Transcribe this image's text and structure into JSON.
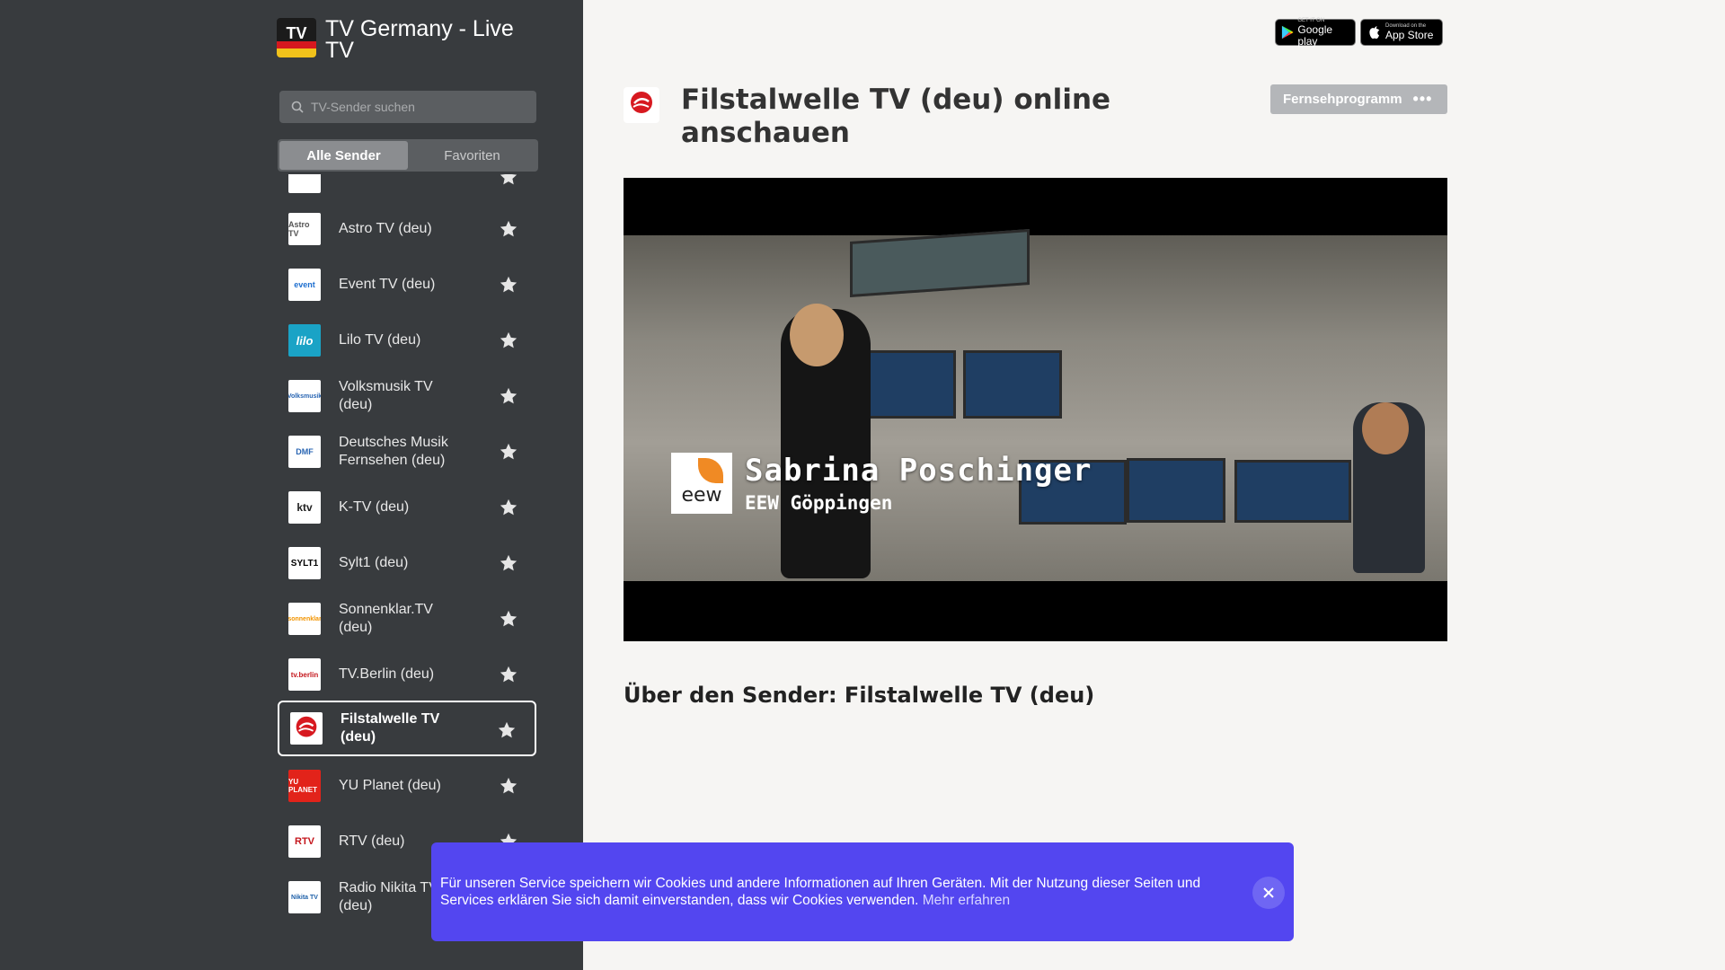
{
  "brand": {
    "title": "TV Germany - Live TV",
    "logo_text": "TV"
  },
  "search": {
    "placeholder": "TV-Sender suchen"
  },
  "tabs": [
    {
      "label": "Alle Sender"
    },
    {
      "label": "Favoriten"
    }
  ],
  "channels": [
    {
      "name": "",
      "logo": ""
    },
    {
      "name": "Astro TV (deu)",
      "logo": "Astro TV"
    },
    {
      "name": "Event TV (deu)",
      "logo": "event"
    },
    {
      "name": "Lilo TV (deu)",
      "logo": "lilo"
    },
    {
      "name": "Volksmusik TV (deu)",
      "logo": "Volksmusik"
    },
    {
      "name": "Deutsches Musik Fernsehen (deu)",
      "logo": "DMF"
    },
    {
      "name": "K-TV (deu)",
      "logo": "ktv"
    },
    {
      "name": "Sylt1 (deu)",
      "logo": "SYLT1"
    },
    {
      "name": "Sonnenklar.TV (deu)",
      "logo": "sonnenklar"
    },
    {
      "name": "TV.Berlin (deu)",
      "logo": "tv.berlin"
    },
    {
      "name": "Filstalwelle TV (deu)",
      "logo": "Filstalwelle"
    },
    {
      "name": "YU Planet (deu)",
      "logo": "YU PLANET"
    },
    {
      "name": "RTV (deu)",
      "logo": "RTV"
    },
    {
      "name": "Radio Nikita TV (deu)",
      "logo": "Nikita TV"
    }
  ],
  "selected_channel": "Filstalwelle TV (deu)",
  "store": {
    "google_small": "GET IT ON",
    "google_big": "Google play",
    "apple_small": "Download on the",
    "apple_big": "App Store"
  },
  "main": {
    "title": "Filstalwelle TV (deu) online anschauen",
    "program_button": "Fernsehprogramm",
    "program_dots": "•••",
    "about": "Über den Sender: Filstalwelle TV (deu)"
  },
  "video": {
    "person_name": "Sabrina Poschinger",
    "organization": "EEW Göppingen",
    "sponsor_logo": "eew"
  },
  "cookie": {
    "text": "Für unseren Service speichern wir Cookies und andere Informationen auf Ihren Geräten. Mit der Nutzung dieser Seiten und Services erklären Sie sich damit einverstanden, dass wir Cookies verwenden.",
    "link": "Mehr erfahren"
  },
  "colors": {
    "sidebar": "#383b3e",
    "cookie_bg": "#5346f0",
    "accent_red": "#d6181f"
  }
}
